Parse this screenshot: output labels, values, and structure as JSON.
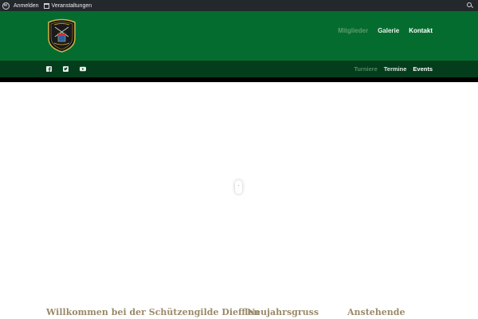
{
  "adminbar": {
    "wp_icon": "wordpress-icon",
    "login_label": "Anmelden",
    "events_label": "Veranstaltungen",
    "calendar_icon": "calendar-icon",
    "search_icon": "search-icon"
  },
  "header": {
    "logo": "club-logo",
    "nav": [
      {
        "label": "Mitglieder"
      },
      {
        "label": "Galerie"
      },
      {
        "label": "Kontakt"
      }
    ]
  },
  "subbar": {
    "social": [
      "facebook-icon",
      "twitter-icon",
      "youtube-icon"
    ],
    "nav": [
      {
        "label": "Turniere"
      },
      {
        "label": "Termine"
      },
      {
        "label": "Events"
      }
    ]
  },
  "content": {
    "col1_heading": "Willkommen bei der Schützengilde Diefflen",
    "col2_heading": "Neujahrsgruss",
    "col3_heading": "Anstehende"
  },
  "colors": {
    "adminbar": "#23282d",
    "header": "#056c2f",
    "subbar": "#043d1c",
    "heading": "#9a8a6a"
  }
}
